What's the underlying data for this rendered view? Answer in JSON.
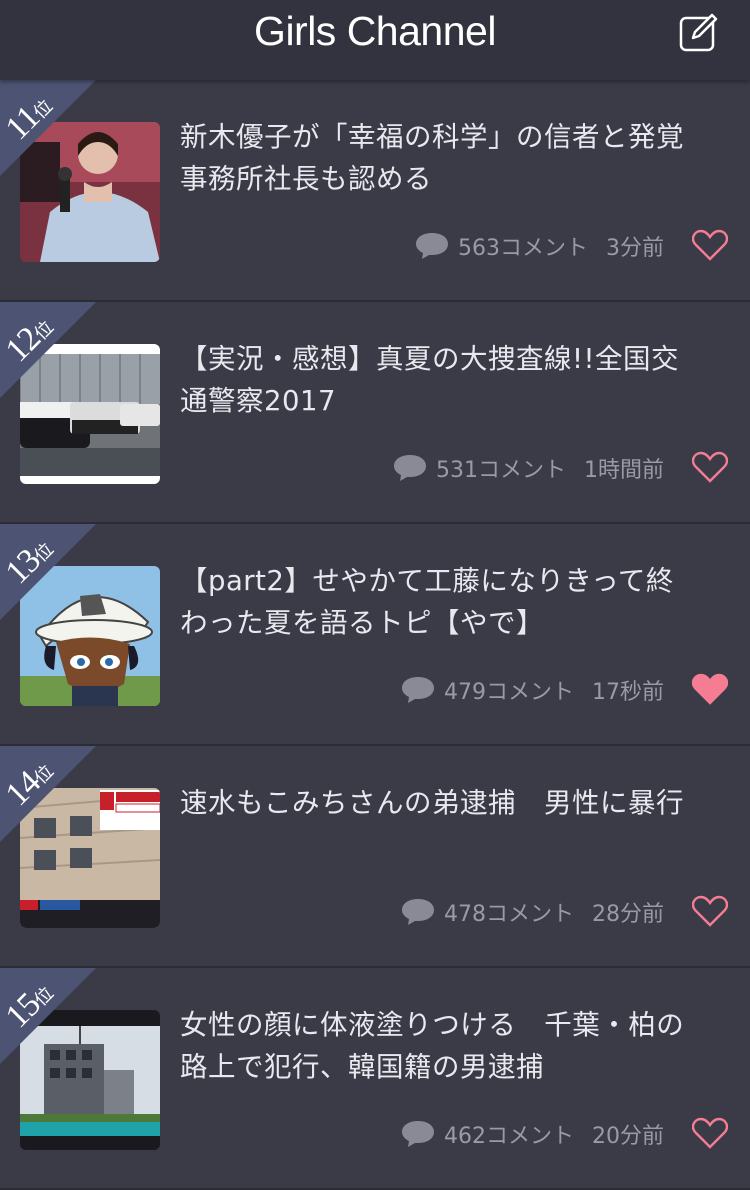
{
  "header": {
    "title": "Girls Channel",
    "edit_icon": "edit-icon"
  },
  "colors": {
    "background": "#3a3a46",
    "header": "#333340",
    "ribbon": "#4d5372",
    "heart": "#f47d93"
  },
  "rank_suffix": "位",
  "items": [
    {
      "rank": "11",
      "title": "新木優子が「幸福の科学」の信者と発覚\n事務所社長も認める",
      "comments": "563コメント",
      "time": "3分前",
      "liked": false
    },
    {
      "rank": "12",
      "title": "【実況・感想】真夏の大捜査線!!全国交\n通警察2017",
      "comments": "531コメント",
      "time": "1時間前",
      "liked": false
    },
    {
      "rank": "13",
      "title": "【part2】せやかて工藤になりきって終\nわった夏を語るトピ【やで】",
      "comments": "479コメント",
      "time": "17秒前",
      "liked": true
    },
    {
      "rank": "14",
      "title": "速水もこみちさんの弟逮捕　男性に暴行",
      "comments": "478コメント",
      "time": "28分前",
      "liked": false
    },
    {
      "rank": "15",
      "title": "女性の顔に体液塗りつける　千葉・柏の\n路上で犯行、韓国籍の男逮捕",
      "comments": "462コメント",
      "time": "20分前",
      "liked": false
    }
  ]
}
